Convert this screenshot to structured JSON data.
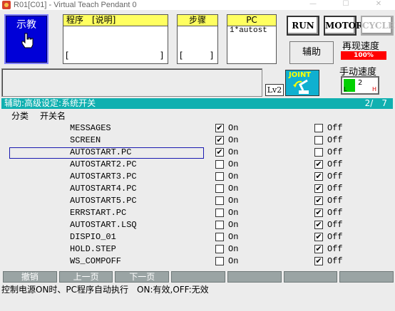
{
  "window": {
    "title": "R01[C01] - Virtual Teach Pendant 0",
    "controls": [
      "—",
      "☐",
      "✕"
    ]
  },
  "teach": {
    "label": "示教"
  },
  "program_box": {
    "header": "程序　[说明]",
    "value": "",
    "bracket_l": "[",
    "bracket_r": "]"
  },
  "step_box": {
    "header": "步骤",
    "bracket_l": "[",
    "bracket_r": "]"
  },
  "pc_box": {
    "header": "PC",
    "value": "1*autost"
  },
  "buttons": {
    "run": "RUN",
    "motor": "MOTOR",
    "cycle": "CYCLE",
    "aux": "辅助"
  },
  "speed": {
    "repeat_label": "再现速度",
    "repeat_value": "100%",
    "manual_label": "手动速度",
    "manual_value": "2",
    "manual_low": "L",
    "manual_high": "H"
  },
  "level": "Lv2",
  "mode": "JOINT",
  "header": {
    "title": "辅助:高级设定:系统开关",
    "page": "2/　7"
  },
  "columns": {
    "category": "分类",
    "name": "开关名"
  },
  "on_label": "On",
  "off_label": "Off",
  "rows": [
    {
      "name": "MESSAGES",
      "on": true,
      "off": false
    },
    {
      "name": "SCREEN",
      "on": true,
      "off": false
    },
    {
      "name": "AUTOSTART.PC",
      "on": true,
      "off": false
    },
    {
      "name": "AUTOSTART2.PC",
      "on": false,
      "off": true
    },
    {
      "name": "AUTOSTART3.PC",
      "on": false,
      "off": true
    },
    {
      "name": "AUTOSTART4.PC",
      "on": false,
      "off": true
    },
    {
      "name": "AUTOSTART5.PC",
      "on": false,
      "off": true
    },
    {
      "name": "ERRSTART.PC",
      "on": false,
      "off": true
    },
    {
      "name": "AUTOSTART.LSQ",
      "on": false,
      "off": true
    },
    {
      "name": "DISPIO_01",
      "on": false,
      "off": true
    },
    {
      "name": "HOLD.STEP",
      "on": false,
      "off": true
    },
    {
      "name": "WS_COMPOFF",
      "on": false,
      "off": true
    }
  ],
  "function_keys": [
    "撤销",
    "上一页",
    "下一页",
    "",
    "",
    "",
    ""
  ],
  "status": "控制电源ON时、PC程序自动执行　ON:有效,OFF:无效",
  "colors": {
    "teach_bg": "#0000d8",
    "header_strip": "#10b0b0",
    "speed_bar": "#ff0000",
    "yellow_header": "#ffff60"
  }
}
